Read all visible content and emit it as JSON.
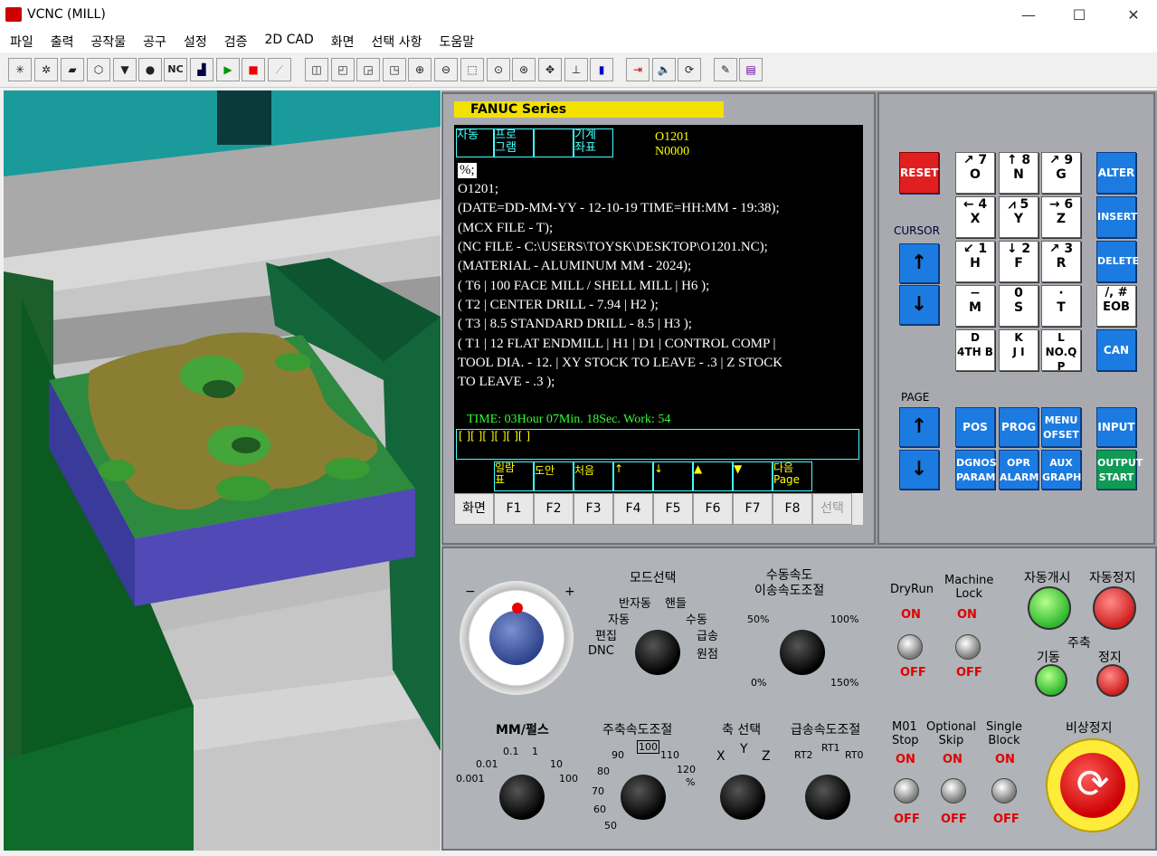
{
  "window": {
    "title": "VCNC (MILL)",
    "min": "—",
    "max": "☐",
    "close": "✕"
  },
  "menu": [
    "파일",
    "출력",
    "공작물",
    "공구",
    "설정",
    "검증",
    "2D CAD",
    "화면",
    "선택 사항",
    "도움말"
  ],
  "toolbar": {
    "nc_label": "NC"
  },
  "crt": {
    "series": "FANUC  Series",
    "tabs": [
      [
        "자동",
        ""
      ],
      [
        "프로",
        "그램"
      ],
      [
        "",
        ""
      ],
      [
        "기계",
        "좌표"
      ]
    ],
    "prog_no": "O1201",
    "seq_no": "N0000",
    "lines": [
      "%;",
      "O1201;",
      "(DATE=DD-MM-YY - 12-10-19 TIME=HH:MM - 19:38);",
      "(MCX FILE - T);",
      "(NC FILE - C:\\USERS\\TOYSK\\DESKTOP\\O1201.NC);",
      "(MATERIAL - ALUMINUM MM - 2024);",
      "( T6 | 100 FACE MILL / SHELL MILL | H6 );",
      "( T2 | CENTER DRILL - 7.94 | H2 );",
      "( T3 | 8.5 STANDARD DRILL - 8.5 | H3 );",
      "( T1 | 12 FLAT ENDMILL | H1 | D1 | CONTROL COMP |",
      "TOOL DIA. - 12. | XY STOCK TO LEAVE - .3 | Z STOCK",
      "TO LEAVE - .3 );"
    ],
    "status": "TIME: 03Hour 07Min. 18Sec.  Work: 54",
    "input_line": "[    ][    ][    ][    ][    ][    ]",
    "softkeys_top": [
      [
        "일람",
        "표"
      ],
      [
        "도안",
        ""
      ],
      [
        "처음",
        ""
      ],
      [
        "↑",
        ""
      ],
      [
        "↓",
        ""
      ],
      [
        "▲",
        ""
      ],
      [
        "▼",
        ""
      ],
      [
        "다음",
        "Page"
      ]
    ],
    "softkeys": [
      "화면",
      "F1",
      "F2",
      "F3",
      "F4",
      "F5",
      "F6",
      "F7",
      "F8",
      "선택"
    ]
  },
  "keypad": {
    "reset": "RESET",
    "cursor": "CURSOR",
    "page": "PAGE",
    "grid": [
      [
        "↗ 7\nO",
        "↑ 8\nN",
        "↗ 9\nG"
      ],
      [
        "← 4\nX",
        "⩘ 5\nY",
        "→ 6\nZ"
      ],
      [
        "↙ 1\nH",
        "↓ 2\nF",
        "↗ 3\nR"
      ],
      [
        "−\nM",
        "0\nS",
        "·\nT"
      ],
      [
        "D\n4TH B",
        "K\nJ I",
        "L\nNO.Q P"
      ]
    ],
    "right": [
      "ALTER",
      "INSERT",
      "DELETE",
      "/, #\nEOB",
      "CAN"
    ],
    "func_row1": [
      "POS",
      "PROG",
      "MENU\nOFSET",
      "INPUT"
    ],
    "func_row2": [
      "DGNOS\nPARAM",
      "OPR\nALARM",
      "AUX\nGRAPH",
      "OUTPUT\nSTART"
    ]
  },
  "panel": {
    "mode_title": "모드선택",
    "modes": [
      "반자동",
      "핸들",
      "자동",
      "수동",
      "편집",
      "급송",
      "DNC",
      "원점"
    ],
    "feed_title": "수동속도\n이송속도조절",
    "feed_marks": [
      "50%",
      "100%",
      "0%",
      "150%"
    ],
    "dryrun": "DryRun",
    "machine_lock": "Machine\nLock",
    "on": "ON",
    "off": "OFF",
    "cycle_start": "자동개시",
    "feed_hold": "자동정지",
    "spindle": "주축",
    "spindle_start": "기동",
    "spindle_stop": "정지",
    "mm_title": "MM/펄스",
    "mm_marks": [
      "0.1",
      "1",
      "0.01",
      "10",
      "0.001",
      "100"
    ],
    "spindle_override_title": "주축속도조절",
    "so_marks": [
      "100",
      "90",
      "110",
      "80",
      "120",
      "70",
      "%",
      "60",
      "50"
    ],
    "axis_title": "축 선택",
    "axes": [
      "X",
      "Y",
      "Z"
    ],
    "rapid_title": "급송속도조절",
    "rapid": [
      "RT1",
      "RT2",
      "RT0"
    ],
    "m01": "M01\nStop",
    "optskip": "Optional\nSkip",
    "single": "Single\nBlock",
    "estop": "비상정지",
    "handwheel_minus": "−",
    "handwheel_plus": "+"
  }
}
